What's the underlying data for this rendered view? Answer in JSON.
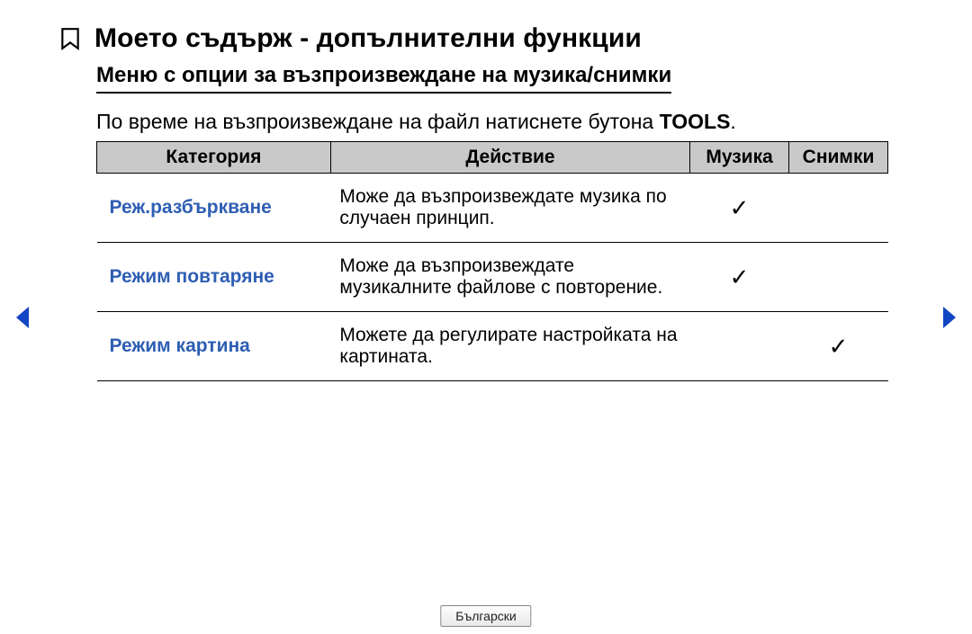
{
  "title": "Моето съдърж - допълнителни функции",
  "subtitle": "Меню с опции за възпроизвеждане на музика/снимки",
  "intro_pre": "По време на възпроизвеждане на файл натиснете бутона ",
  "intro_bold": "TOOLS",
  "intro_post": ".",
  "headers": {
    "category": "Категория",
    "action": "Действие",
    "music": "Музика",
    "photos": "Снимки"
  },
  "rows": [
    {
      "category": "Реж.разбъркване",
      "action": "Може да възпроизвеждате музика по случаен принцип.",
      "music": "✓",
      "photos": ""
    },
    {
      "category": "Режим повтаряне",
      "action": "Може да възпроизвеждате музикалните файлове с повторение.",
      "music": "✓",
      "photos": ""
    },
    {
      "category": "Режим картина",
      "action": "Можете да регулирате настройката на картината.",
      "music": "",
      "photos": "✓"
    }
  ],
  "language": "Български",
  "chart_data": {
    "type": "table",
    "title": "Меню с опции за възпроизвеждане на музика/снимки",
    "columns": [
      "Категория",
      "Действие",
      "Музика",
      "Снимки"
    ],
    "rows": [
      [
        "Реж.разбъркване",
        "Може да възпроизвеждате музика по случаен принцип.",
        true,
        false
      ],
      [
        "Режим повтаряне",
        "Може да възпроизвеждате музикалните файлове с повторение.",
        true,
        false
      ],
      [
        "Режим картина",
        "Можете да регулирате настройката на картината.",
        false,
        true
      ]
    ]
  }
}
